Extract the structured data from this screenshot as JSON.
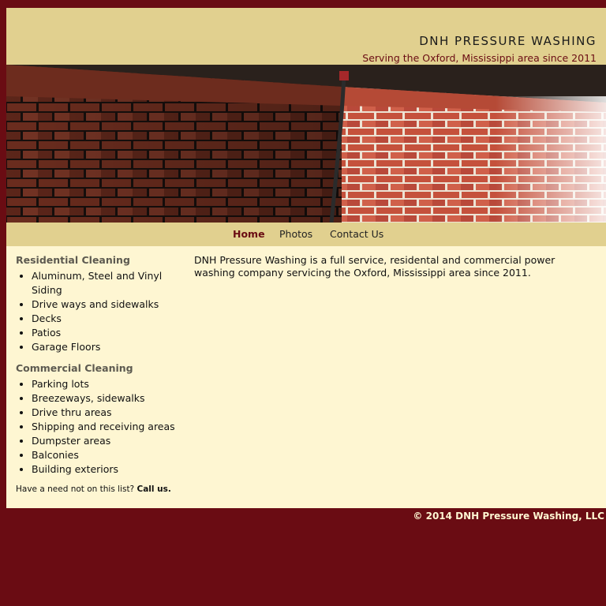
{
  "header": {
    "title": "DNH PRESSURE WASHING",
    "tagline": "Serving the Oxford, Mississippi area since 2011"
  },
  "banner": {
    "image_icon": "brick-wall-pressure-washing-photo"
  },
  "nav": {
    "items": [
      {
        "label": "Home",
        "active": true
      },
      {
        "label": "Photos",
        "active": false
      },
      {
        "label": "Contact Us",
        "active": false
      }
    ]
  },
  "sidebar": {
    "residential": {
      "heading": "Residential Cleaning",
      "items": [
        "Aluminum, Steel and Vinyl Siding",
        "Drive ways and sidewalks",
        "Decks",
        "Patios",
        "Garage Floors"
      ]
    },
    "commercial": {
      "heading": "Commercial Cleaning",
      "items": [
        "Parking lots",
        "Breezeways, sidewalks",
        "Drive thru areas",
        "Shipping and receiving areas",
        "Dumpster areas",
        "Balconies",
        "Building exteriors"
      ]
    },
    "need_note": "Have a need not on this list?",
    "call_link": "Call us."
  },
  "main": {
    "intro": "DNH Pressure Washing is a full service, residental and commercial power washing company servicing the Oxford, Mississippi area since 2011."
  },
  "footer": {
    "copyright": "© 2014 DNH Pressure Washing, LLC"
  },
  "colors": {
    "background": "#6a0c13",
    "header_bg": "#e1d08f",
    "content_bg": "#fef6d2",
    "accent": "#6a0c13"
  }
}
